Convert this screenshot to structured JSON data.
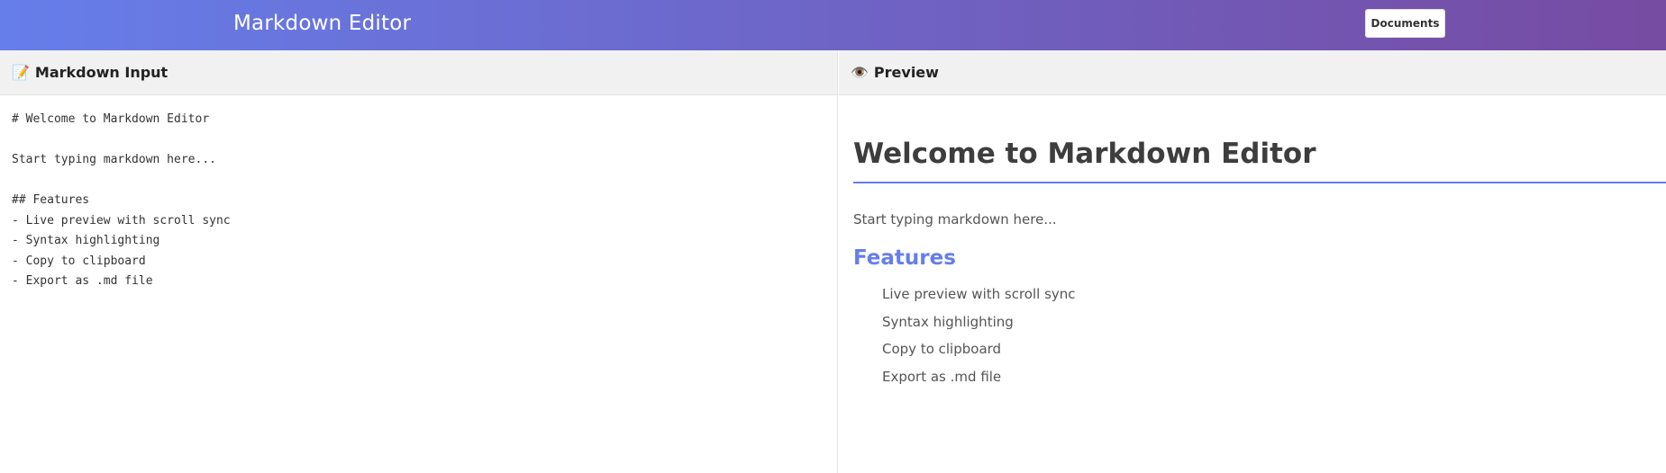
{
  "header": {
    "title": "Markdown Editor",
    "documents_label": "Documents",
    "gradient": [
      "#667eea",
      "#764ba2"
    ]
  },
  "editor_pane": {
    "icon": "memo-icon",
    "icon_glyph": "📝",
    "title": "Markdown Input",
    "content": "# Welcome to Markdown Editor\n\nStart typing markdown here...\n\n## Features\n- Live preview with scroll sync\n- Syntax highlighting\n- Copy to clipboard\n- Export as .md file"
  },
  "preview_pane": {
    "icon": "eye-icon",
    "icon_glyph": "👁️",
    "title": "Preview",
    "h1": "Welcome to Markdown Editor",
    "paragraph": "Start typing markdown here...",
    "h2": "Features",
    "items": [
      "Live preview with scroll sync",
      "Syntax highlighting",
      "Copy to clipboard",
      "Export as .md file"
    ],
    "accent_color": "#667eea"
  }
}
